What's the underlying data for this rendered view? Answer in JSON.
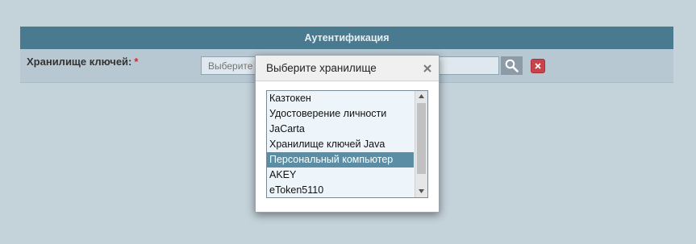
{
  "section": {
    "title": "Аутентификация"
  },
  "form": {
    "keystore_label": "Хранилище ключей:",
    "required_mark": "*",
    "keystore_placeholder": "Выберите"
  },
  "dialog": {
    "title": "Выберите хранилище",
    "items": [
      {
        "label": "Казтокен",
        "selected": false
      },
      {
        "label": "Удостоверение личности",
        "selected": false
      },
      {
        "label": "JaCarta",
        "selected": false
      },
      {
        "label": "Хранилище ключей Java",
        "selected": false
      },
      {
        "label": "Персональный компьютер",
        "selected": true
      },
      {
        "label": "AKEY",
        "selected": false
      },
      {
        "label": "eToken5110",
        "selected": false
      }
    ],
    "scroll_position": 0
  },
  "icons": {
    "search": "search-icon",
    "clear": "close-icon",
    "dialog_close": "close-icon",
    "scroll_up": "chevron-up-icon",
    "scroll_down": "chevron-down-icon"
  },
  "colors": {
    "page_background": "#c4d2da",
    "section_header": "#4a7a90",
    "form_row": "#b7c8d2",
    "clear_button": "#c9434b",
    "selected_item": "#5b8ea4",
    "required_mark": "#d12a2a"
  }
}
